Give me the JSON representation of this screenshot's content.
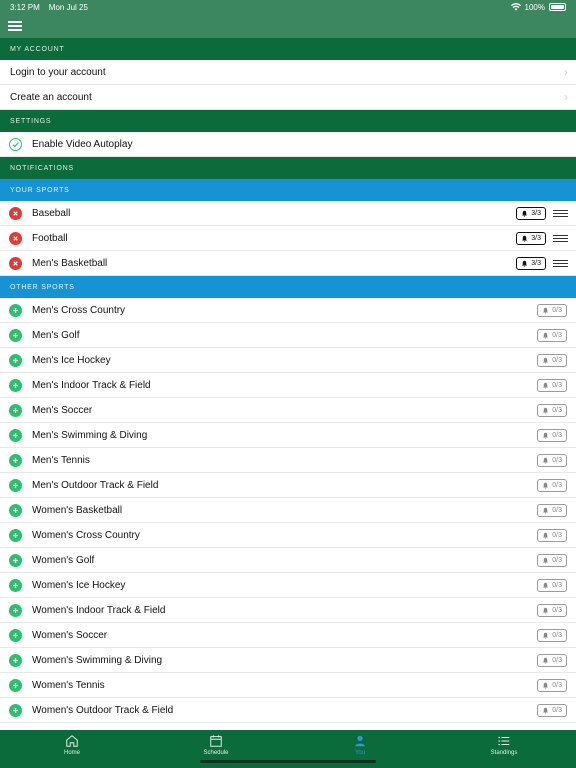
{
  "status": {
    "time": "3:12 PM",
    "date": "Mon Jul 25",
    "battery": "100%"
  },
  "sections": {
    "my_account": "MY ACCOUNT",
    "settings": "SETTINGS",
    "notifications": "NOTIFICATIONS",
    "your_sports": "YOUR SPORTS",
    "other_sports": "OTHER SPORTS"
  },
  "account": {
    "login": "Login to your account",
    "create": "Create an account"
  },
  "settings": {
    "autoplay": "Enable Video Autoplay"
  },
  "your_sports": [
    {
      "name": "Baseball",
      "count": "3/3"
    },
    {
      "name": "Football",
      "count": "3/3"
    },
    {
      "name": "Men's Basketball",
      "count": "3/3"
    }
  ],
  "other_sports": [
    {
      "name": "Men's Cross Country",
      "count": "0/3"
    },
    {
      "name": "Men's Golf",
      "count": "0/3"
    },
    {
      "name": "Men's Ice Hockey",
      "count": "0/3"
    },
    {
      "name": "Men's Indoor Track & Field",
      "count": "0/3"
    },
    {
      "name": "Men's Soccer",
      "count": "0/3"
    },
    {
      "name": "Men's Swimming & Diving",
      "count": "0/3"
    },
    {
      "name": "Men's Tennis",
      "count": "0/3"
    },
    {
      "name": "Men's Outdoor Track & Field",
      "count": "0/3"
    },
    {
      "name": "Women's Basketball",
      "count": "0/3"
    },
    {
      "name": "Women's Cross Country",
      "count": "0/3"
    },
    {
      "name": "Women's Golf",
      "count": "0/3"
    },
    {
      "name": "Women's Ice Hockey",
      "count": "0/3"
    },
    {
      "name": "Women's Indoor Track & Field",
      "count": "0/3"
    },
    {
      "name": "Women's Soccer",
      "count": "0/3"
    },
    {
      "name": "Women's Swimming & Diving",
      "count": "0/3"
    },
    {
      "name": "Women's Tennis",
      "count": "0/3"
    },
    {
      "name": "Women's Outdoor Track & Field",
      "count": "0/3"
    }
  ],
  "tabs": [
    {
      "label": "Home",
      "icon": "home-icon"
    },
    {
      "label": "Schedule",
      "icon": "calendar-icon"
    },
    {
      "label": "You",
      "icon": "person-icon",
      "active": true
    },
    {
      "label": "Standings",
      "icon": "list-icon"
    }
  ],
  "colors": {
    "header_green": "#0c6b3b",
    "nav_green": "#3d8760",
    "sports_blue": "#1593d4",
    "remove_red": "#e53935",
    "add_green": "#2bc06d",
    "active_tab": "#2a9bd6"
  }
}
